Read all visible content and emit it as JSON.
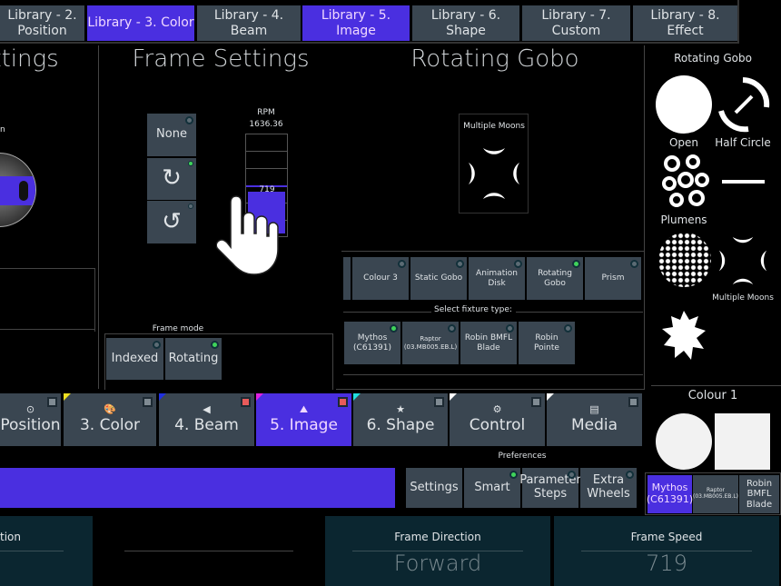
{
  "library_tabs": [
    {
      "label": "Library - 2. Position",
      "active": false
    },
    {
      "label": "Library - 3. Color",
      "active": true
    },
    {
      "label": "Library - 4. Beam",
      "active": false
    },
    {
      "label": "Library - 5. Image",
      "active": true
    },
    {
      "label": "Library - 6. Shape",
      "active": false
    },
    {
      "label": "Library - 7. Custom",
      "active": false
    },
    {
      "label": "Library - 8. Effect",
      "active": false
    }
  ],
  "left_panel": {
    "title": "ettings",
    "label": "n"
  },
  "frame_settings": {
    "title": "Frame Settings",
    "none_label": "None",
    "rpm_label": "RPM",
    "rpm_value": "1636.36",
    "speed_value": "719",
    "frame_mode_label": "Frame mode",
    "indexed_label": "Indexed",
    "rotating_label": "Rotating"
  },
  "rotating_gobo": {
    "title": "Rotating Gobo",
    "selected_gobo": "Multiple Moons",
    "gobo_types": [
      "Colour 3",
      "Static Gobo",
      "Animation Disk",
      "Rotating Gobo",
      "Prism"
    ],
    "active_gobo_type": "Rotating Gobo",
    "select_fixture_label": "Select fixture type:",
    "fixtures": [
      "Mythos (C61391)",
      "Raptor (03.MB005.EB.L)",
      "Robin BMFL Blade",
      "Robin Pointe"
    ]
  },
  "right_panel": {
    "title": "Rotating Gobo",
    "gobos": [
      "Open",
      "Half Circle",
      "Plumens",
      "",
      "",
      "Multiple Moons",
      ""
    ],
    "colour_title": "Colour 1",
    "fixtures": [
      "Mythos (C61391)",
      "Raptor (03.MB005.EB.L)",
      "Robin BMFL Blade"
    ]
  },
  "attribute_tabs": [
    {
      "label": "Position",
      "icon": "position-icon",
      "corner": "#ffffff"
    },
    {
      "label": "3. Color",
      "icon": "palette-icon",
      "corner": "#f0e020"
    },
    {
      "label": "4. Beam",
      "icon": "beam-icon",
      "corner": "#2030e0"
    },
    {
      "label": "5. Image",
      "icon": "image-icon",
      "corner": "#e020e0"
    },
    {
      "label": "6. Shape",
      "icon": "star-icon",
      "corner": "#20e0e0"
    },
    {
      "label": "Control",
      "icon": "control-icon",
      "corner": "#ffffff"
    },
    {
      "label": "Media",
      "icon": "media-icon",
      "corner": "#ffffff"
    }
  ],
  "preferences": {
    "title": "Preferences",
    "buttons": [
      "Settings",
      "Smart",
      "Parameter Steps",
      "Extra Wheels"
    ]
  },
  "bottom": {
    "left_label": "tion",
    "frame_direction_label": "Frame Direction",
    "frame_direction_value": "Forward",
    "frame_speed_label": "Frame Speed",
    "frame_speed_value": "719"
  },
  "colors": {
    "accent": "#4a2fe0",
    "button": "#3a4651",
    "indicator_on": "#3fd35a",
    "panel": "#0b2630"
  }
}
